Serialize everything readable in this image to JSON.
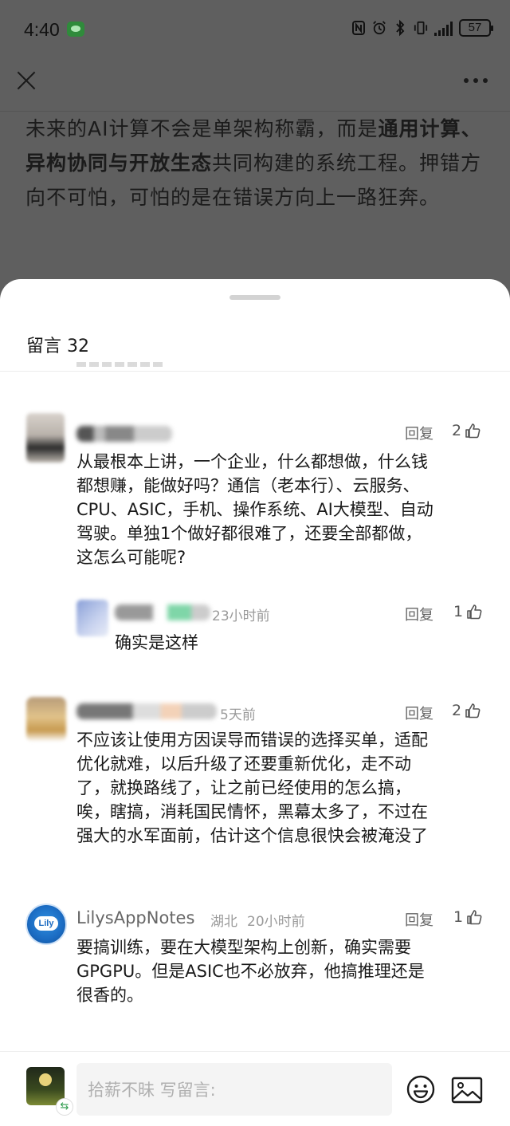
{
  "status_bar": {
    "time": "4:40",
    "battery": "57"
  },
  "article": {
    "segments": [
      {
        "text": "未来的AI计算不会是单架构称霸，而是",
        "bold": false
      },
      {
        "text": "通用计算、异构协同与开放生态",
        "bold": true
      },
      {
        "text": "共同构建的系统工程。押错方向不可怕，可怕的是在错误方向上一路狂奔。",
        "bold": false
      }
    ]
  },
  "comments_panel": {
    "title": "留言 32",
    "comments": [
      {
        "reply_label": "回复",
        "likes": "2",
        "content": [
          "从最根本上讲，一个企业，什么都想做，什么钱",
          "都想赚，能做好吗？通信（老本行）、云服务、",
          "CPU、ASIC，手机、操作系统、AI大模型、自动",
          "驾驶。单独1个做好都很难了，还要全部都做，",
          "这怎么可能呢?"
        ],
        "reply": {
          "time": "23小时前",
          "reply_label": "回复",
          "likes": "1",
          "content": "确实是这样"
        }
      },
      {
        "time": "5天前",
        "reply_label": "回复",
        "likes": "2",
        "content": [
          "不应该让使用方因误导而错误的选择买单，适配",
          "优化就难，以后升级了还要重新优化，走不动",
          "了，就换路线了，让之前已经使用的怎么搞，",
          "唉，瞎搞，消耗国民情怀，黑幕太多了，不过在",
          "强大的水军面前，估计这个信息很快会被淹没了"
        ]
      },
      {
        "author": "LilysAppNotes",
        "location": "湖北",
        "time": "20小时前",
        "reply_label": "回复",
        "likes": "1",
        "avatar_text": "Lily",
        "content": [
          "要搞训练，要在大模型架构上创新，确实需要",
          "GPGPU。但是ASIC也不必放弃，他搞推理还是",
          "很香的。"
        ]
      }
    ]
  },
  "bottom_bar": {
    "input_placeholder": "拾薪不昧 写留言:"
  },
  "colors": {
    "overlay": "#5f5f5f",
    "lily_avatar": "#1b73c9",
    "icon": "#1a1a1a"
  }
}
